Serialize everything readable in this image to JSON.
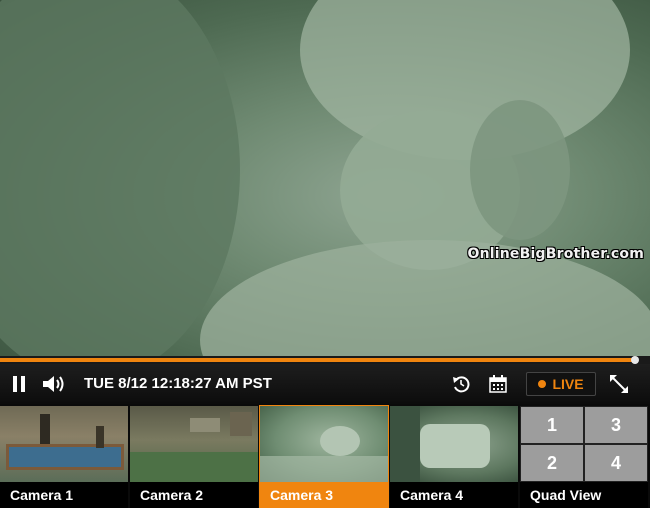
{
  "video": {
    "watermark": "OnlineBigBrother.com"
  },
  "progress": {
    "played_fraction": 0.98
  },
  "controls": {
    "pause_icon": "pause-icon",
    "volume_icon": "volume-icon",
    "timestamp": "TUE 8/12 12:18:27 AM PST",
    "replay_icon": "replay-icon",
    "calendar_icon": "calendar-icon",
    "live_label": "LIVE",
    "fullscreen_icon": "fullscreen-icon"
  },
  "cameras": [
    {
      "label": "Camera 1",
      "active": false
    },
    {
      "label": "Camera 2",
      "active": false
    },
    {
      "label": "Camera 3",
      "active": true
    },
    {
      "label": "Camera 4",
      "active": false
    },
    {
      "label": "Quad View",
      "active": false,
      "cells": [
        "1",
        "3",
        "2",
        "4"
      ]
    }
  ],
  "colors": {
    "accent": "#f0850f",
    "bar": "#111111",
    "night_vision": "#6f8a72"
  }
}
